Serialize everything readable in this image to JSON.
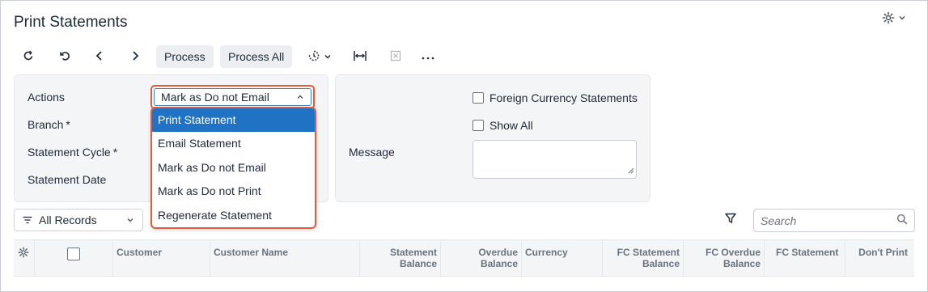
{
  "page": {
    "title": "Print Statements"
  },
  "toolbar": {
    "process_label": "Process",
    "process_all_label": "Process All"
  },
  "form": {
    "actions_label": "Actions",
    "actions_value": "Mark as Do not Email",
    "branch_label": "Branch",
    "statement_cycle_label": "Statement Cycle",
    "statement_date_label": "Statement Date",
    "required_mark": "*",
    "foreign_currency_label": "Foreign Currency Statements",
    "show_all_label": "Show All",
    "message_label": "Message"
  },
  "dropdown": {
    "options": [
      "Print Statement",
      "Email Statement",
      "Mark as Do not Email",
      "Mark as Do not Print",
      "Regenerate Statement"
    ],
    "highlighted": "Print Statement"
  },
  "grid": {
    "filter_value": "All Records",
    "search_placeholder": "Search",
    "columns": {
      "customer": "Customer",
      "customer_name": "Customer Name",
      "statement_balance_1": "Statement",
      "statement_balance_2": "Balance",
      "overdue_balance_1": "Overdue",
      "overdue_balance_2": "Balance",
      "currency": "Currency",
      "fc_statement_balance_1": "FC Statement",
      "fc_statement_balance_2": "Balance",
      "fc_overdue_balance_1": "FC Overdue",
      "fc_overdue_balance_2": "Balance",
      "fc_statement": "FC Statement",
      "dont_print": "Don't Print"
    }
  },
  "colors": {
    "accent": "#1f72c4",
    "highlight_border": "#e55a3c",
    "panel_bg": "#f4f5f7"
  }
}
